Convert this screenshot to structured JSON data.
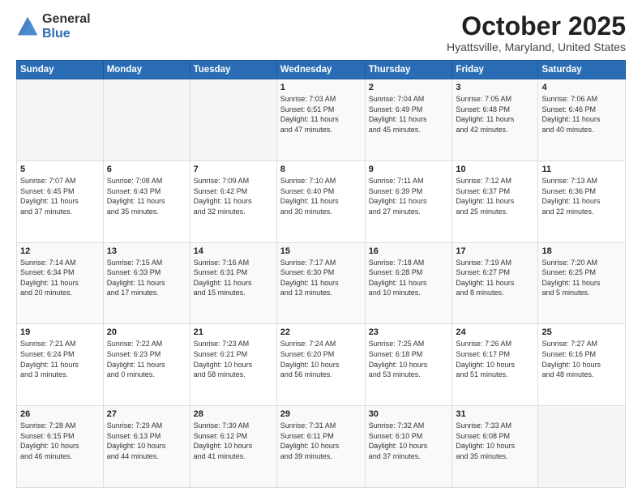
{
  "logo": {
    "general": "General",
    "blue": "Blue"
  },
  "title": "October 2025",
  "location": "Hyattsville, Maryland, United States",
  "days_header": [
    "Sunday",
    "Monday",
    "Tuesday",
    "Wednesday",
    "Thursday",
    "Friday",
    "Saturday"
  ],
  "weeks": [
    [
      {
        "day": "",
        "info": ""
      },
      {
        "day": "",
        "info": ""
      },
      {
        "day": "",
        "info": ""
      },
      {
        "day": "1",
        "info": "Sunrise: 7:03 AM\nSunset: 6:51 PM\nDaylight: 11 hours\nand 47 minutes."
      },
      {
        "day": "2",
        "info": "Sunrise: 7:04 AM\nSunset: 6:49 PM\nDaylight: 11 hours\nand 45 minutes."
      },
      {
        "day": "3",
        "info": "Sunrise: 7:05 AM\nSunset: 6:48 PM\nDaylight: 11 hours\nand 42 minutes."
      },
      {
        "day": "4",
        "info": "Sunrise: 7:06 AM\nSunset: 6:46 PM\nDaylight: 11 hours\nand 40 minutes."
      }
    ],
    [
      {
        "day": "5",
        "info": "Sunrise: 7:07 AM\nSunset: 6:45 PM\nDaylight: 11 hours\nand 37 minutes."
      },
      {
        "day": "6",
        "info": "Sunrise: 7:08 AM\nSunset: 6:43 PM\nDaylight: 11 hours\nand 35 minutes."
      },
      {
        "day": "7",
        "info": "Sunrise: 7:09 AM\nSunset: 6:42 PM\nDaylight: 11 hours\nand 32 minutes."
      },
      {
        "day": "8",
        "info": "Sunrise: 7:10 AM\nSunset: 6:40 PM\nDaylight: 11 hours\nand 30 minutes."
      },
      {
        "day": "9",
        "info": "Sunrise: 7:11 AM\nSunset: 6:39 PM\nDaylight: 11 hours\nand 27 minutes."
      },
      {
        "day": "10",
        "info": "Sunrise: 7:12 AM\nSunset: 6:37 PM\nDaylight: 11 hours\nand 25 minutes."
      },
      {
        "day": "11",
        "info": "Sunrise: 7:13 AM\nSunset: 6:36 PM\nDaylight: 11 hours\nand 22 minutes."
      }
    ],
    [
      {
        "day": "12",
        "info": "Sunrise: 7:14 AM\nSunset: 6:34 PM\nDaylight: 11 hours\nand 20 minutes."
      },
      {
        "day": "13",
        "info": "Sunrise: 7:15 AM\nSunset: 6:33 PM\nDaylight: 11 hours\nand 17 minutes."
      },
      {
        "day": "14",
        "info": "Sunrise: 7:16 AM\nSunset: 6:31 PM\nDaylight: 11 hours\nand 15 minutes."
      },
      {
        "day": "15",
        "info": "Sunrise: 7:17 AM\nSunset: 6:30 PM\nDaylight: 11 hours\nand 13 minutes."
      },
      {
        "day": "16",
        "info": "Sunrise: 7:18 AM\nSunset: 6:28 PM\nDaylight: 11 hours\nand 10 minutes."
      },
      {
        "day": "17",
        "info": "Sunrise: 7:19 AM\nSunset: 6:27 PM\nDaylight: 11 hours\nand 8 minutes."
      },
      {
        "day": "18",
        "info": "Sunrise: 7:20 AM\nSunset: 6:25 PM\nDaylight: 11 hours\nand 5 minutes."
      }
    ],
    [
      {
        "day": "19",
        "info": "Sunrise: 7:21 AM\nSunset: 6:24 PM\nDaylight: 11 hours\nand 3 minutes."
      },
      {
        "day": "20",
        "info": "Sunrise: 7:22 AM\nSunset: 6:23 PM\nDaylight: 11 hours\nand 0 minutes."
      },
      {
        "day": "21",
        "info": "Sunrise: 7:23 AM\nSunset: 6:21 PM\nDaylight: 10 hours\nand 58 minutes."
      },
      {
        "day": "22",
        "info": "Sunrise: 7:24 AM\nSunset: 6:20 PM\nDaylight: 10 hours\nand 56 minutes."
      },
      {
        "day": "23",
        "info": "Sunrise: 7:25 AM\nSunset: 6:18 PM\nDaylight: 10 hours\nand 53 minutes."
      },
      {
        "day": "24",
        "info": "Sunrise: 7:26 AM\nSunset: 6:17 PM\nDaylight: 10 hours\nand 51 minutes."
      },
      {
        "day": "25",
        "info": "Sunrise: 7:27 AM\nSunset: 6:16 PM\nDaylight: 10 hours\nand 48 minutes."
      }
    ],
    [
      {
        "day": "26",
        "info": "Sunrise: 7:28 AM\nSunset: 6:15 PM\nDaylight: 10 hours\nand 46 minutes."
      },
      {
        "day": "27",
        "info": "Sunrise: 7:29 AM\nSunset: 6:13 PM\nDaylight: 10 hours\nand 44 minutes."
      },
      {
        "day": "28",
        "info": "Sunrise: 7:30 AM\nSunset: 6:12 PM\nDaylight: 10 hours\nand 41 minutes."
      },
      {
        "day": "29",
        "info": "Sunrise: 7:31 AM\nSunset: 6:11 PM\nDaylight: 10 hours\nand 39 minutes."
      },
      {
        "day": "30",
        "info": "Sunrise: 7:32 AM\nSunset: 6:10 PM\nDaylight: 10 hours\nand 37 minutes."
      },
      {
        "day": "31",
        "info": "Sunrise: 7:33 AM\nSunset: 6:08 PM\nDaylight: 10 hours\nand 35 minutes."
      },
      {
        "day": "",
        "info": ""
      }
    ]
  ]
}
